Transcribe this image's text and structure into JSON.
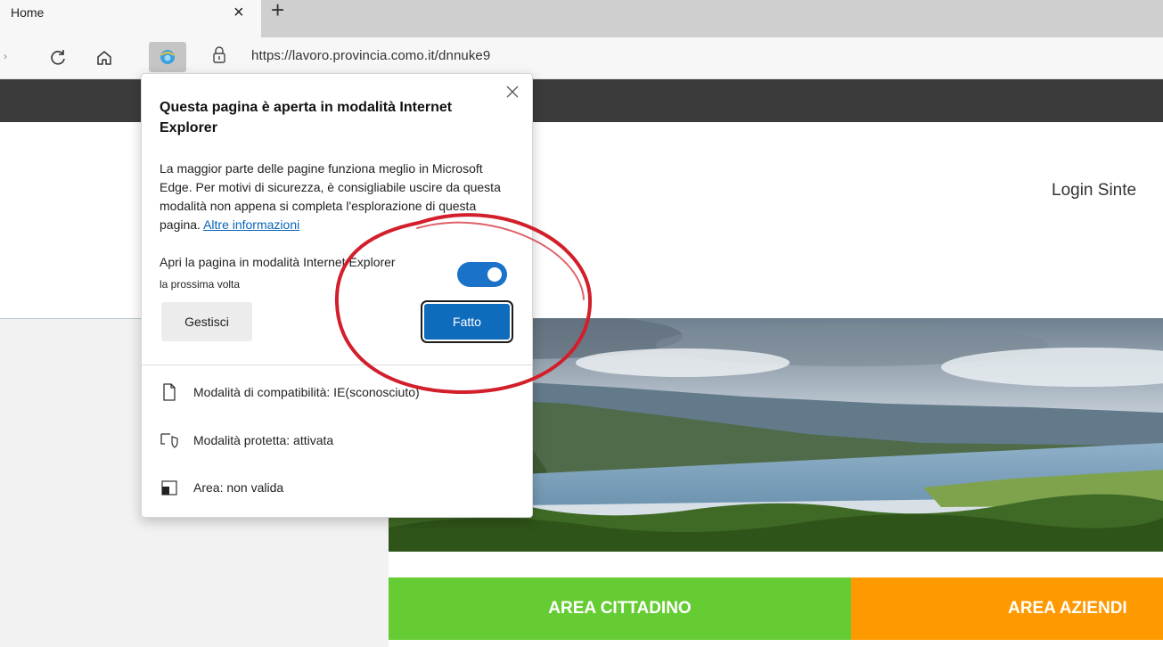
{
  "browser": {
    "tab_title": "Home",
    "tab_close": "×",
    "new_tab": "+",
    "url": "https://lavoro.provincia.como.it/dnnuke9"
  },
  "page": {
    "login_text": "Login Sinte",
    "area_cittadino": "AREA CITTADINO",
    "area_aziende": "AREA AZIENDI"
  },
  "popup": {
    "title": "Questa pagina è aperta in modalità Internet Explorer",
    "body": "La maggior parte delle pagine funziona meglio in Microsoft Edge. Per motivi di sicurezza, è consigliabile uscire da questa modalità non appena si completa l'esplorazione di questa pagina.",
    "link": "Altre informazioni",
    "toggle_label": "Apri la pagina in modalità Internet Explorer",
    "toggle_sub": "la prossima volta",
    "toggle_on": true,
    "manage_label": "Gestisci",
    "done_label": "Fatto",
    "info": [
      {
        "icon": "page-icon",
        "text": "Modalità di compatibilità: IE(sconosciuto)"
      },
      {
        "icon": "protected-mode-icon",
        "text": "Modalità protetta: attivata"
      },
      {
        "icon": "zone-icon",
        "text": "Area: non valida"
      }
    ]
  },
  "colors": {
    "accent": "#0f6cbd",
    "header": "#3b3b3b",
    "area_cittadino": "#66cc33",
    "area_aziende": "#ff9900",
    "annotation": "#d21f2b"
  }
}
